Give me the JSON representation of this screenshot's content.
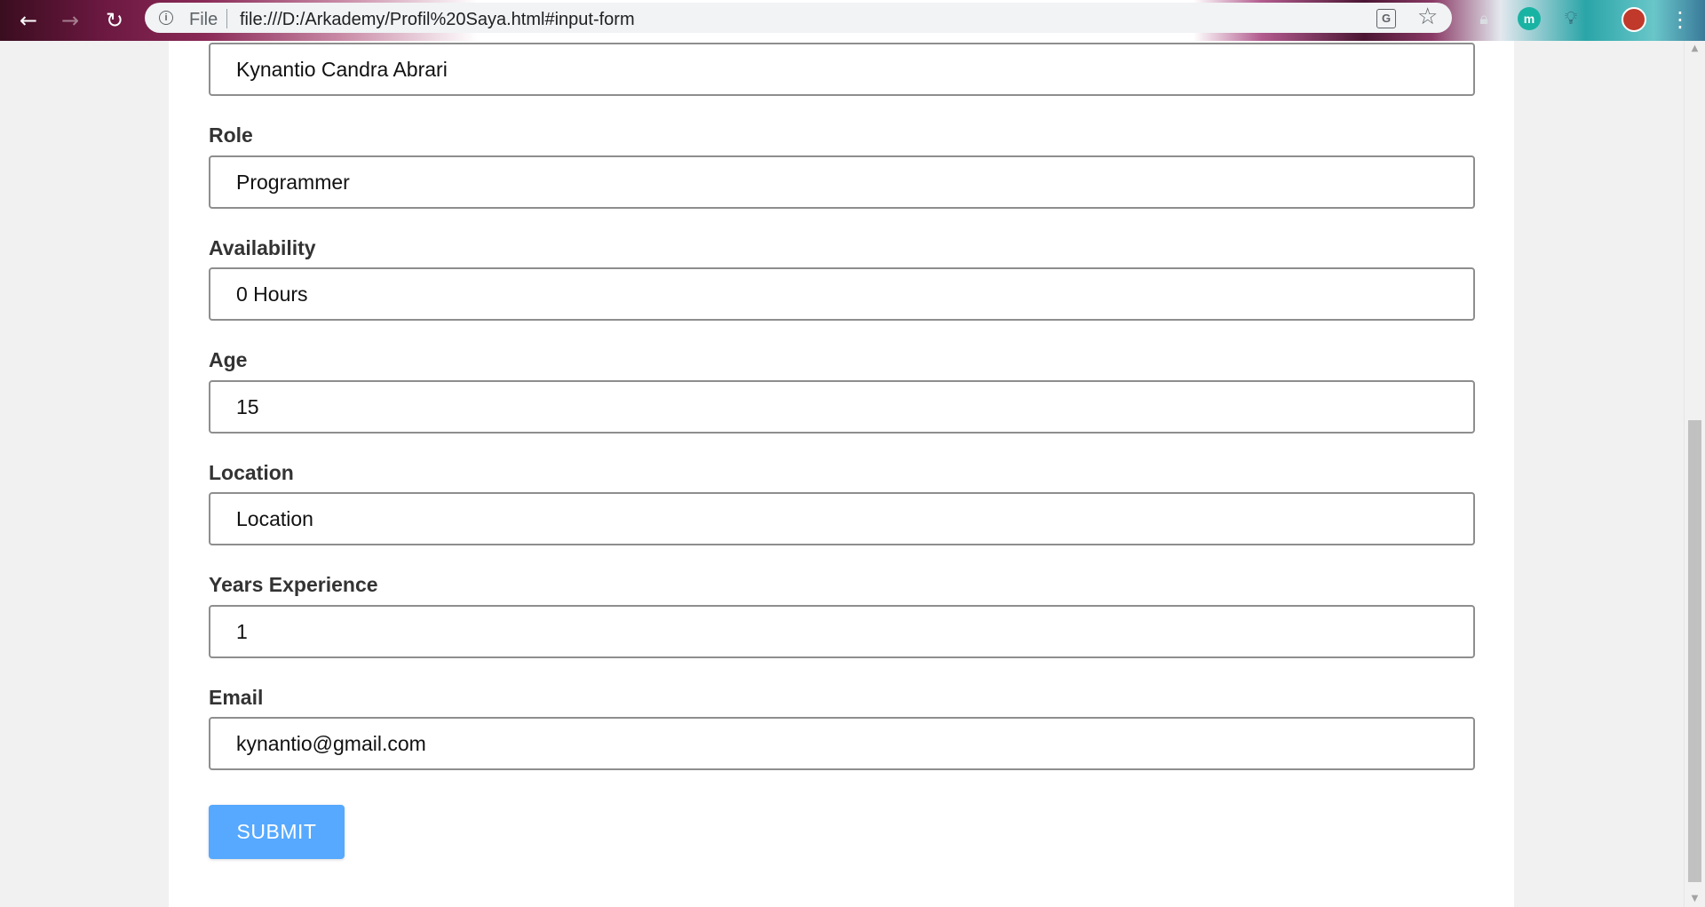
{
  "browser": {
    "url_scheme": "File",
    "url": "file:///D:/Arkademy/Profil%20Saya.html#input-form",
    "icons": {
      "back": "back-arrow-icon",
      "forward": "forward-arrow-icon",
      "reload": "reload-icon",
      "info": "info-icon",
      "translate": "translate-icon",
      "bookmark": "star-icon",
      "menu": "three-dots-menu-icon"
    },
    "extensions": {
      "m_label": "m"
    }
  },
  "form": {
    "name": {
      "value": "Kynantio Candra Abrari"
    },
    "role": {
      "label": "Role",
      "value": "Programmer"
    },
    "availability": {
      "label": "Availability",
      "value": "0 Hours"
    },
    "age": {
      "label": "Age",
      "value": "15"
    },
    "location": {
      "label": "Location",
      "placeholder": "Location",
      "value": ""
    },
    "years_experience": {
      "label": "Years Experience",
      "value": "1"
    },
    "email": {
      "label": "Email",
      "value": "kynantio@gmail.com"
    },
    "submit_label": "SUBMIT"
  },
  "scrollbar": {
    "position": 0.72
  },
  "colors": {
    "submit_button": "#56a9ff",
    "input_border": "#8e8e8e",
    "label_text": "#333333"
  }
}
